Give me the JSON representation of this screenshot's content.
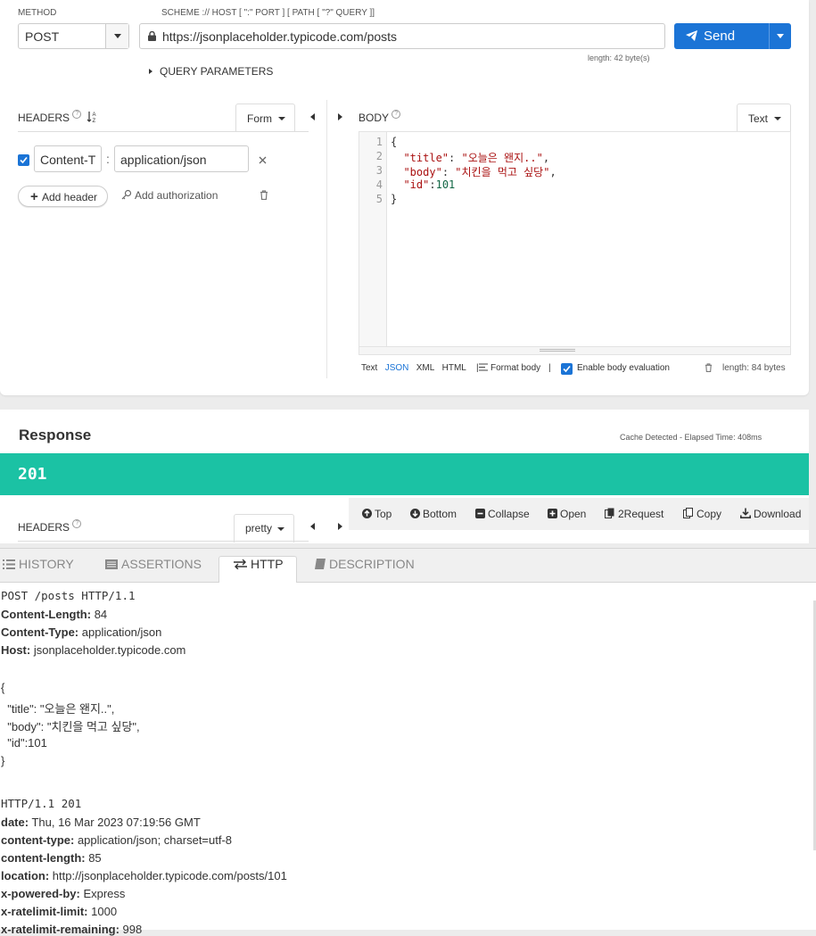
{
  "request": {
    "method_label": "METHOD",
    "method_value": "POST",
    "url_label": "SCHEME :// HOST [ \":\" PORT ] [ PATH [ \"?\" QUERY ]]",
    "url_value": "https://jsonplaceholder.typicode.com/posts",
    "url_length": "length: 42 byte(s)",
    "send_label": "Send",
    "query_params_label": "QUERY PARAMETERS"
  },
  "headers": {
    "title": "HEADERS",
    "mode": "Form",
    "rows": [
      {
        "enabled": true,
        "name": "Content-T",
        "separator": ":",
        "value": "application/json"
      }
    ],
    "add_header_label": "Add header",
    "add_auth_label": "Add authorization"
  },
  "body": {
    "title": "BODY",
    "mode": "Text",
    "line_numbers": [
      "1",
      "2",
      "3",
      "4",
      "5"
    ],
    "lines": [
      [
        {
          "t": "p",
          "v": "{"
        }
      ],
      [
        {
          "t": "p",
          "v": "  "
        },
        {
          "t": "k",
          "v": "\"title\""
        },
        {
          "t": "p",
          "v": ": "
        },
        {
          "t": "s",
          "v": "\"오늘은 왠지..\""
        },
        {
          "t": "p",
          "v": ","
        }
      ],
      [
        {
          "t": "p",
          "v": "  "
        },
        {
          "t": "k",
          "v": "\"body\""
        },
        {
          "t": "p",
          "v": ": "
        },
        {
          "t": "s",
          "v": "\"치킨을 먹고 싶당\""
        },
        {
          "t": "p",
          "v": ","
        }
      ],
      [
        {
          "t": "p",
          "v": "  "
        },
        {
          "t": "k",
          "v": "\"id\""
        },
        {
          "t": "p",
          "v": ":"
        },
        {
          "t": "n",
          "v": "101"
        }
      ],
      [
        {
          "t": "p",
          "v": "}"
        }
      ]
    ],
    "formats": [
      "Text",
      "JSON",
      "XML",
      "HTML"
    ],
    "active_format": "JSON",
    "separator": "|",
    "format_body_label": "Format body",
    "enable_eval_label": "Enable body evaluation",
    "enable_eval_checked": true,
    "length": "length: 84 bytes"
  },
  "response": {
    "title": "Response",
    "cache_info": "Cache Detected - Elapsed Time: 408ms",
    "status_code": "201",
    "headers_title": "HEADERS",
    "view_mode": "pretty",
    "toolbar": {
      "top": "Top",
      "bottom": "Bottom",
      "collapse": "Collapse",
      "open": "Open",
      "to_request": "2Request",
      "copy": "Copy",
      "download": "Download"
    }
  },
  "bottom_tabs": {
    "history": "HISTORY",
    "assertions": "ASSERTIONS",
    "http": "HTTP",
    "description": "DESCRIPTION",
    "active": "HTTP"
  },
  "http_view": {
    "request_line": "POST /posts HTTP/1.1",
    "request_headers": [
      {
        "name": "Content-Length:",
        "value": " 84"
      },
      {
        "name": "Content-Type:",
        "value": " application/json"
      },
      {
        "name": "Host:",
        "value": " jsonplaceholder.typicode.com"
      }
    ],
    "request_body": [
      "{",
      "  \"title\": \"오늘은 왠지..\",",
      "  \"body\": \"치킨을 먹고 싶당\",",
      "  \"id\":101",
      "}"
    ],
    "response_line": "HTTP/1.1 201",
    "response_headers": [
      {
        "name": "date:",
        "value": " Thu, 16 Mar 2023 07:19:56 GMT"
      },
      {
        "name": "content-type:",
        "value": " application/json; charset=utf-8"
      },
      {
        "name": "content-length:",
        "value": " 85"
      },
      {
        "name": "location:",
        "value": " http://jsonplaceholder.typicode.com/posts/101"
      },
      {
        "name": "x-powered-by:",
        "value": " Express"
      },
      {
        "name": "x-ratelimit-limit:",
        "value": " 1000"
      },
      {
        "name": "x-ratelimit-remaining:",
        "value": " 998"
      }
    ]
  },
  "colors": {
    "accent": "#1b74d6",
    "status_success": "#1bc2a4"
  }
}
